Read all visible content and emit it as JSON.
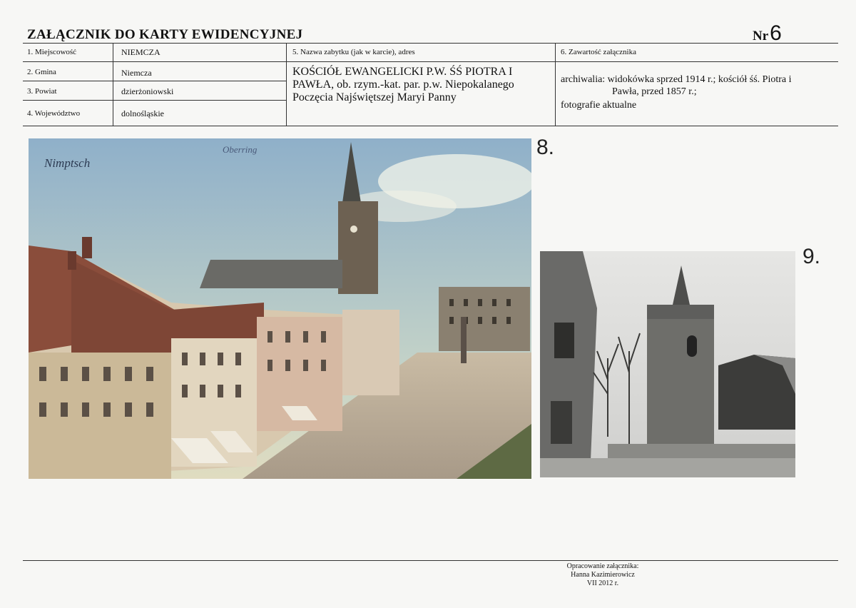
{
  "header": {
    "title": "ZAŁĄCZNIK DO KARTY EWIDENCYJNEJ",
    "nr_label": "Nr",
    "nr_value": "6"
  },
  "table": {
    "locality_label": "1. Miejscowość",
    "locality_value": "NIEMCZA",
    "gmina_label": "2. Gmina",
    "gmina_value": "Niemcza",
    "powiat_label": "3. Powiat",
    "powiat_value": "dzierżoniowski",
    "voivodeship_label": "4. Województwo",
    "voivodeship_value": "dolnośląskie",
    "monument_label": "5. Nazwa zabytku (jak w karcie), adres",
    "monument_value": "KOŚCIÓŁ EWANGELICKI P.W. ŚŚ PIOTRA I PAWŁA, ob. rzym.-kat. par. p.w. Niepokalanego Poczęcia Najświętszej Maryi Panny",
    "contents_label": "6. Zawartość załącznika",
    "contents_line1": "archiwalia: widokówka sprzed 1914 r.; kościół śś. Piotra i",
    "contents_line2": "Pawła, przed 1857 r.;",
    "contents_line3": "fotografie aktualne"
  },
  "photos": [
    {
      "number": "8.",
      "caption_left": "Nimptsch",
      "caption_top": "Oberring"
    },
    {
      "number": "9."
    }
  ],
  "footer": {
    "line1": "Opracowanie załącznika:",
    "line2": "Hanna Kazimierowicz",
    "line3": "VII 2012 r."
  }
}
